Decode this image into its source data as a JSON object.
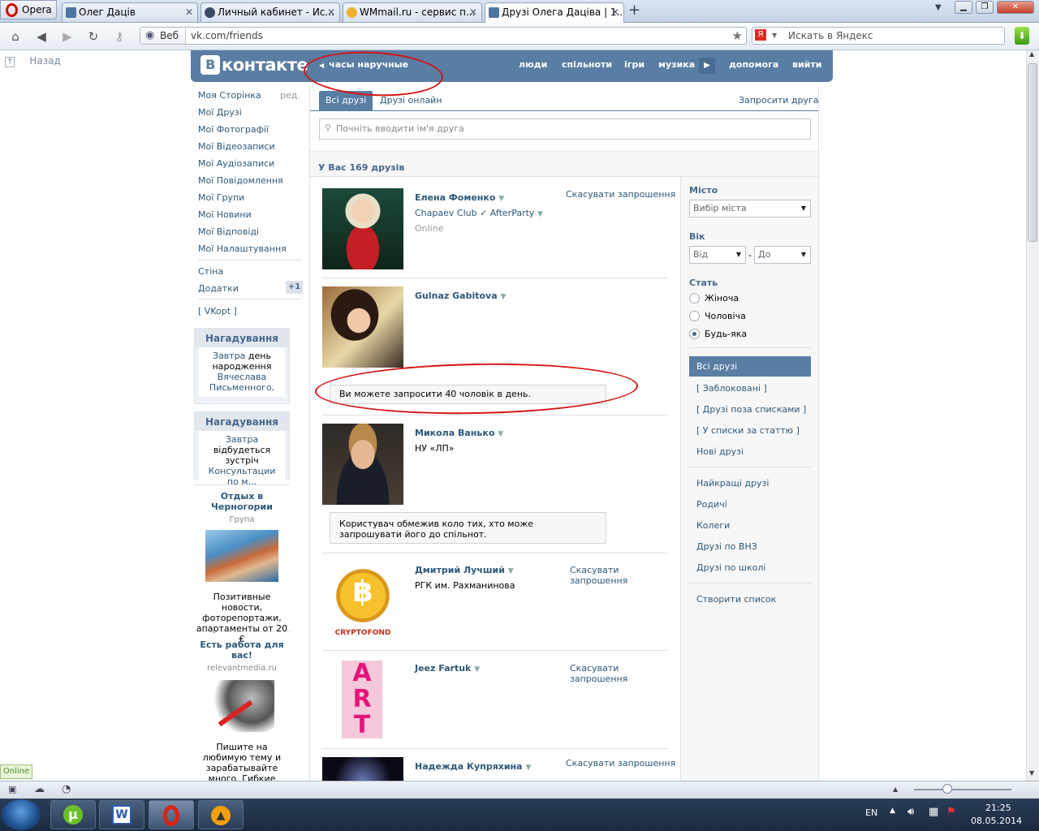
{
  "browser": {
    "menu_label": "Opera",
    "tabs": [
      {
        "title": "Олег Даців"
      },
      {
        "title": "Личный кабинет - Ис..."
      },
      {
        "title": "WMmail.ru - сервис п..."
      },
      {
        "title": "Друзі Олега Даціва | 1..."
      }
    ],
    "web_label": "Веб",
    "url": "vk.com/friends",
    "search_placeholder": "Искать в Яндекс",
    "back_label": "Назад",
    "online_label": "Online"
  },
  "vk": {
    "logo": "контакте",
    "logo_letter": "В",
    "status": "часы наручные",
    "nav": [
      "люди",
      "спільноти",
      "ігри",
      "музика",
      "допомога",
      "вийти"
    ]
  },
  "menu": {
    "items": [
      "Моя Сторінка",
      "Мої Друзі",
      "Мої Фотографії",
      "Мої Відеозаписи",
      "Мої Аудіозаписи",
      "Мої Повідомлення",
      "Мої Групи",
      "Мої Новини",
      "Мої Відповіді",
      "Мої Налаштування"
    ],
    "edit": "ред.",
    "wall": "Стіна",
    "apps": "Додатки",
    "apps_badge": "+1",
    "vkopt": "[ VKopt ]"
  },
  "reminders": [
    {
      "title": "Нагадування",
      "pre": "Завтра",
      "mid": " день народження ",
      "link": "Вячеслава Письменного",
      "post": "."
    },
    {
      "title": "Нагадування",
      "pre": "Завтра",
      "mid": " відбудеться зустріч ",
      "link": "Консультации по м..."
    }
  ],
  "ads": [
    {
      "title": "Отдых в Черногории",
      "sub": "Група",
      "text": "Позитивные новости, фоторепортажи, апартаменты от 20 €"
    },
    {
      "title": "Есть работа для вас!",
      "sub": "relevantmedia.ru",
      "text": "Пишите на любимую тему и зарабатывайте много. Гибкие сроки!"
    }
  ],
  "friends_page": {
    "tabs": [
      "Всі друзі",
      "Друзі онлайн"
    ],
    "invite": "Запросити друга",
    "search_placeholder": "Почніть вводити ім'я друга",
    "summary": "У Вас 169 друзів"
  },
  "friends": [
    {
      "name": "Елена Фоменко",
      "info": "Chapaev Club ✓ AfterParty",
      "status": "Online",
      "action": "Скасувати запрошення"
    },
    {
      "name": "Gulnaz Gabitova",
      "notice": "Ви можете запросити 40 чоловік в день."
    },
    {
      "name": "Микола Ванько",
      "info": "НУ «ЛП»",
      "notice": "Користувач обмежив коло тих, хто може запрошувати його до спільнот."
    },
    {
      "name": "Дмитрий Лучший",
      "info": "РГК им. Рахманинова",
      "action": "Скасувати запрошення",
      "photo_text": "CRYPTOFOND"
    },
    {
      "name": "Jeez Fartuk",
      "action": "Скасувати запрошення",
      "photo_text": "ART"
    },
    {
      "name": "Надежда Купряхина",
      "action": "Скасувати запрошення"
    }
  ],
  "filter": {
    "city_label": "Місто",
    "city_select": "Вибір міста",
    "age_label": "Вік",
    "age_from": "Від",
    "age_dash": "-",
    "age_to": "До",
    "sex_label": "Стать",
    "sex_options": [
      "Жіноча",
      "Чоловіча",
      "Будь-яка"
    ],
    "lists": [
      "Всі друзі",
      "[ Заблоковані ]",
      "[ Друзі поза списками ]",
      "[ У списки за статтю ]",
      "Нові друзі",
      "Найкращі друзі",
      "Родичі",
      "Колеги",
      "Друзі по ВНЗ",
      "Друзі по школі",
      "Створити список"
    ]
  },
  "taskbar": {
    "lang": "EN",
    "time": "21:25",
    "date": "08.05.2014"
  },
  "colors": {
    "vk_blue": "#597da3",
    "link": "#2b587a",
    "annotation": "#d51414"
  }
}
